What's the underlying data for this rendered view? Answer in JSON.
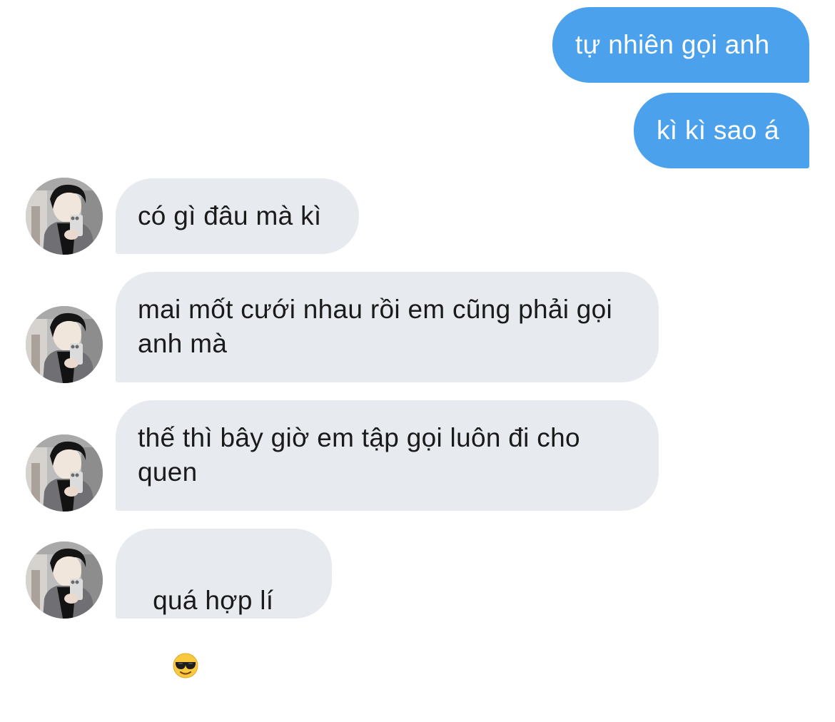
{
  "conversation": {
    "messages": [
      {
        "sender": "me",
        "text": "tự nhiên gọi anh"
      },
      {
        "sender": "me",
        "text": "kì kì sao á"
      },
      {
        "sender": "other",
        "text": "có gì đâu mà kì"
      },
      {
        "sender": "other",
        "text": "mai mốt cưới nhau rồi em cũng phải gọi anh mà"
      },
      {
        "sender": "other",
        "text": "thế thì bây giờ em tập gọi luôn đi cho quen"
      },
      {
        "sender": "other",
        "text": "quá hợp lí",
        "emoji": "sunglasses-emoji"
      }
    ]
  },
  "colors": {
    "sent_bubble": "#4ba1eb",
    "received_bubble": "#e7ebf0",
    "sent_text": "#ffffff",
    "received_text": "#1a1a1a"
  },
  "icons": {
    "avatar": "avatar-photo",
    "emoji": "sunglasses-emoji"
  }
}
